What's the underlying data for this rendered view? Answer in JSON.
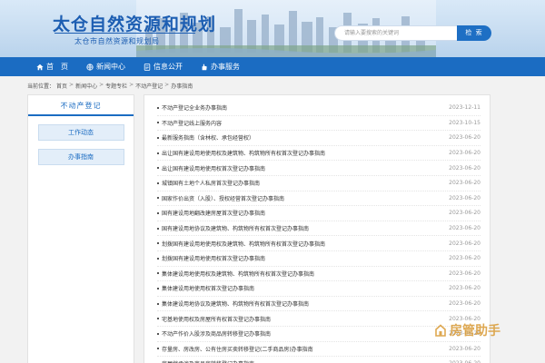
{
  "header": {
    "title": "太仓自然资源和规划",
    "subtitle": "太仓市自然资源和规划局",
    "search_placeholder": "请输入要搜索的关键词",
    "search_button": "检 索"
  },
  "nav": {
    "items": [
      {
        "label": "首　页",
        "icon": "home-icon"
      },
      {
        "label": "新闻中心",
        "icon": "globe-icon"
      },
      {
        "label": "信息公开",
        "icon": "document-icon"
      },
      {
        "label": "办事服务",
        "icon": "hand-icon"
      }
    ]
  },
  "breadcrumb": {
    "prefix": "当前位置：",
    "items": [
      "首页",
      "新闻中心",
      "专题专栏",
      "不动产登记",
      "办事指南"
    ]
  },
  "sidebar": {
    "title": "不动产登记",
    "items": [
      "工作动态",
      "办事指南"
    ]
  },
  "articles": [
    {
      "title": "不动产登记全业务办事指南",
      "date": "2023-12-11"
    },
    {
      "title": "不动产登记线上服务内容",
      "date": "2023-10-15"
    },
    {
      "title": "最新服务指南（含林权、承包经营权）",
      "date": "2023-06-20"
    },
    {
      "title": "出让国有建设用地使用权及建筑物、构筑物所有权首次登记办事指南",
      "date": "2023-06-20"
    },
    {
      "title": "出让国有建设用地使用权首次登记办事指南",
      "date": "2023-06-20"
    },
    {
      "title": "城镇国有土地个人私房首次登记办事指南",
      "date": "2023-06-20"
    },
    {
      "title": "国家作价出资（入股）、授权经营首次登记办事指南",
      "date": "2023-06-20"
    },
    {
      "title": "国有建设用地翻改建房屋首次登记办事指南",
      "date": "2023-06-20"
    },
    {
      "title": "国有建设用地协议及建筑物、构筑物所有权首次登记办事指南",
      "date": "2023-06-20"
    },
    {
      "title": "划拨国有建设用地使用权及建筑物、构筑物所有权首次登记办事指南",
      "date": "2023-06-20"
    },
    {
      "title": "划拨国有建设用地使用权首次登记办事指南",
      "date": "2023-06-20"
    },
    {
      "title": "集体建设用地使用权及建筑物、构筑物所有权首次登记办事指南",
      "date": "2023-06-20"
    },
    {
      "title": "集体建设用地使用权首次登记办事指南",
      "date": "2023-06-20"
    },
    {
      "title": "集体建设用地协议及建筑物、构筑物所有权首次登记办事指南",
      "date": "2023-06-20"
    },
    {
      "title": "宅基地使用权及房屋所有权首次登记办事指南",
      "date": "2023-06-20"
    },
    {
      "title": "不动产作价入股涉及商品房转移登记办事指南",
      "date": "2023-06-20"
    },
    {
      "title": "存量房、房改房、公有住房买卖转移登记(二手商品房)办事指南",
      "date": "2023-06-20"
    },
    {
      "title": "房屋继承涉及商品房转移登记办事指南",
      "date": "2023-06-20"
    }
  ],
  "watermark": {
    "text": "房管助手"
  },
  "colors": {
    "brand": "#1b6cc2",
    "title": "#1d5eb2",
    "watermark": "#d99a34"
  }
}
